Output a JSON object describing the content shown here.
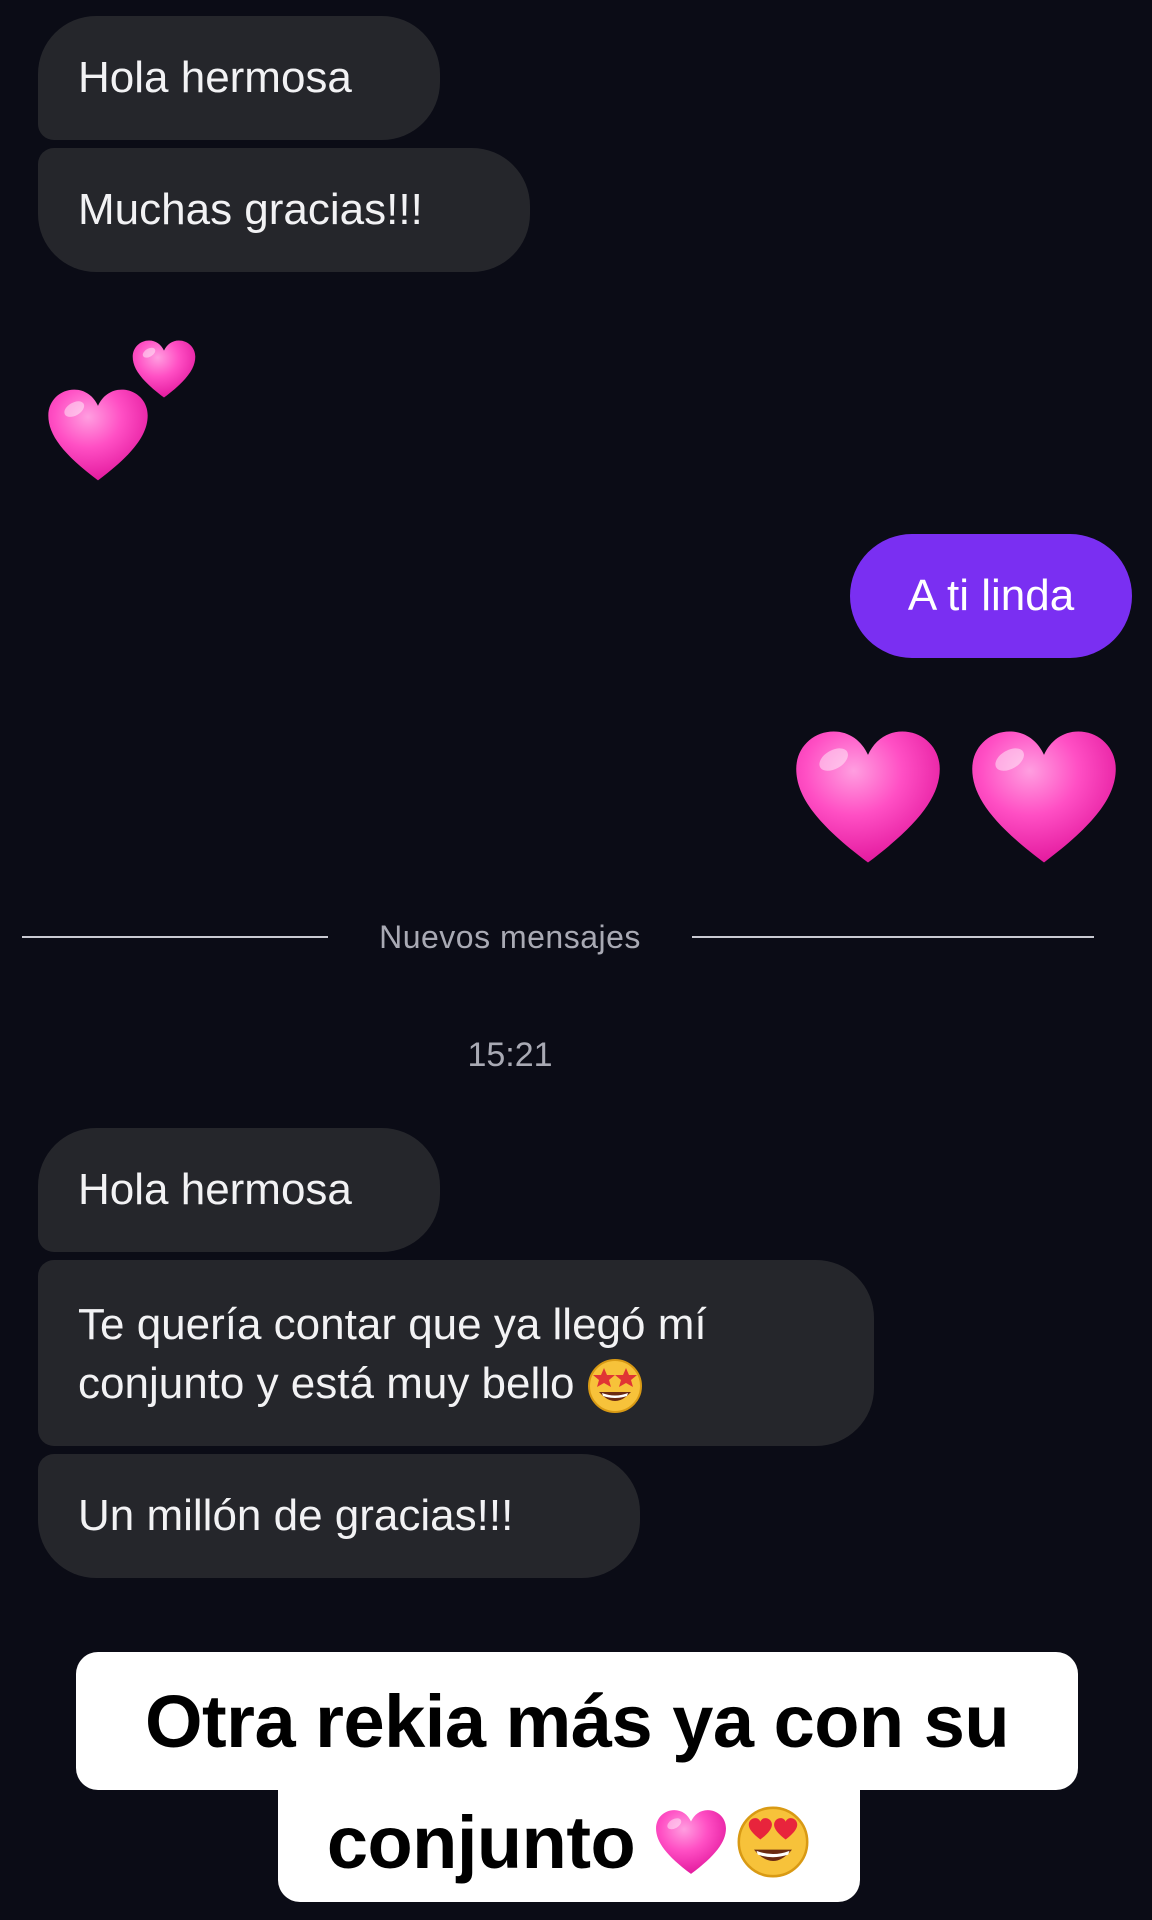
{
  "conversation": {
    "messages_before": [
      {
        "text": "Hola hermosa"
      },
      {
        "text": "Muchas gracias!!!"
      }
    ],
    "incoming_reaction": {
      "icon": "two-hearts-icon",
      "color": "#ff4fb8"
    },
    "outgoing_message": {
      "text": "A ti linda",
      "color": "#7a2ff2"
    },
    "outgoing_reaction": {
      "icon": "pink-heart-icon",
      "count": 2,
      "color": "#ff4fb8"
    },
    "new_messages_divider": "Nuevos mensajes",
    "timestamp": "15:21",
    "messages_after": [
      {
        "text": "Hola hermosa"
      },
      {
        "line1": "Te quería contar que ya llegó mí",
        "line2": "conjunto y está muy bello",
        "emoji": "star-struck-icon"
      },
      {
        "text": "Un millón de gracias!!!"
      }
    ]
  },
  "caption": {
    "line1": "Otra rekia más ya con su",
    "line2": "conjunto",
    "emojis": [
      "pink-heart-icon",
      "heart-eyes-icon"
    ]
  },
  "colors": {
    "background": "#0b0c16",
    "incoming_bubble": "#25262b",
    "outgoing_bubble": "#7a2ff2",
    "heart": "#ff4fb8"
  }
}
